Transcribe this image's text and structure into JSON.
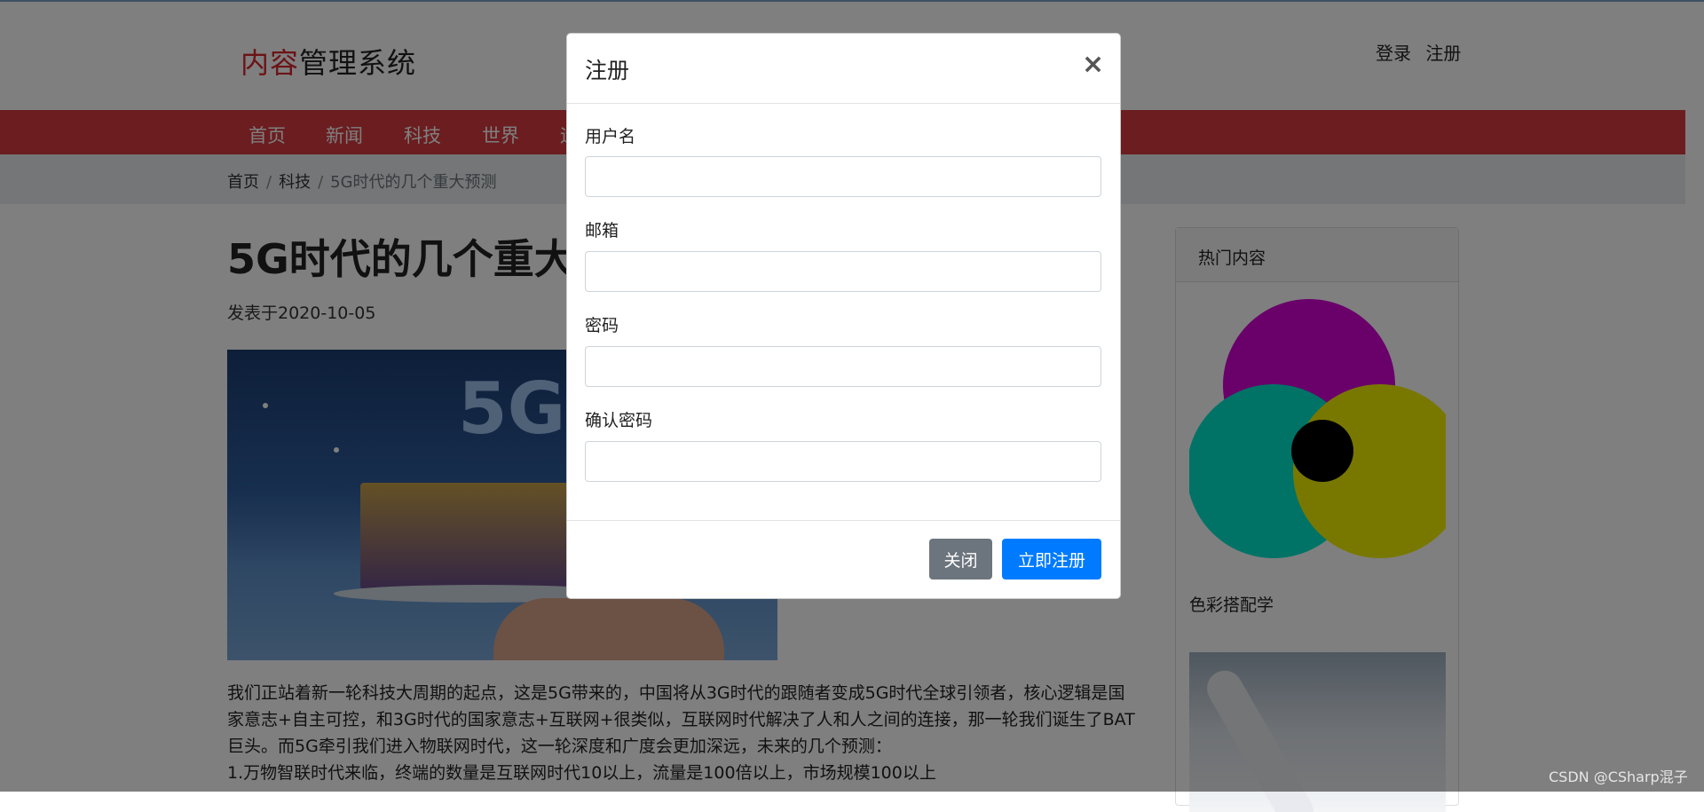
{
  "site": {
    "logo_accent": "内容",
    "logo_rest": "管理系统",
    "auth": {
      "login": "登录",
      "register": "注册"
    }
  },
  "nav": {
    "items": [
      "首页",
      "新闻",
      "科技",
      "世界",
      "运"
    ]
  },
  "breadcrumb": {
    "home": "首页",
    "category": "科技",
    "current": "5G时代的几个重大预测"
  },
  "article": {
    "title": "5G时代的几个重大预测",
    "date": "发表于2020-10-05",
    "paragraph": "我们正站着新一轮科技大周期的起点，这是5G带来的，中国将从3G时代的跟随者变成5G时代全球引领者，核心逻辑是国家意志+自主可控，和3G时代的国家意志+互联网+很类似，互联网时代解决了人和人之间的连接，那一轮我们诞生了BAT巨头。而5G牵引我们进入物联网时代，这一轮深度和广度会更加深远，未来的几个预测：",
    "paragraph2": "1.万物智联时代来临，终端的数量是互联网时代10以上，流量是100倍以上，市场规模100以上",
    "hero_text": "5G"
  },
  "sidebar": {
    "title": "热门内容",
    "item1_caption": "色彩搭配学"
  },
  "modal": {
    "title": "注册",
    "close_symbol": "×",
    "fields": [
      {
        "label": "用户名",
        "value": ""
      },
      {
        "label": "邮箱",
        "value": ""
      },
      {
        "label": "密码",
        "value": ""
      },
      {
        "label": "确认密码",
        "value": ""
      }
    ],
    "close_button": "关闭",
    "submit_button": "立即注册"
  },
  "watermark": "CSDN @CSharp混子",
  "colors": {
    "nav": "#d63a3f",
    "primary": "#007bff",
    "secondary": "#6c757d",
    "logo_accent": "#d9262c"
  }
}
